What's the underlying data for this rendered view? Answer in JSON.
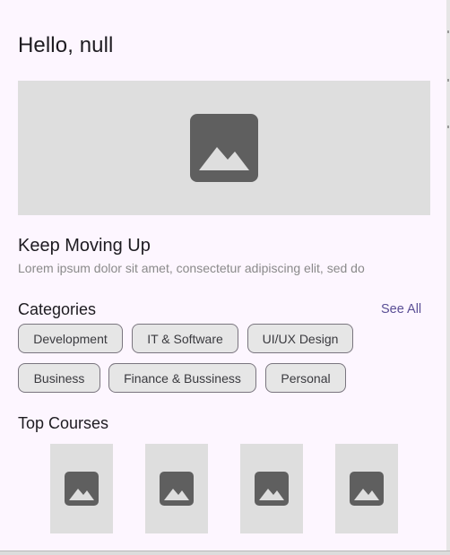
{
  "header": {
    "greeting": "Hello, null"
  },
  "banner": {
    "image_icon": "image-placeholder-icon"
  },
  "intro": {
    "title": "Keep Moving Up",
    "subtitle": "Lorem ipsum dolor sit amet, consectetur adipiscing elit, sed do"
  },
  "categories": {
    "title": "Categories",
    "see_all": "See All",
    "chips": [
      "Development",
      "IT & Software",
      "UI/UX Design",
      "Business",
      "Finance & Bussiness",
      "Personal"
    ]
  },
  "top_courses": {
    "title": "Top Courses",
    "items": [
      {
        "icon": "image-placeholder-icon"
      },
      {
        "icon": "image-placeholder-icon"
      },
      {
        "icon": "image-placeholder-icon"
      },
      {
        "icon": "image-placeholder-icon"
      }
    ]
  },
  "colors": {
    "background": "#fdf6ff",
    "placeholder": "#dedede",
    "icon": "#5f5f5f",
    "accent": "#5b4f96",
    "chip_bg": "#e6e6e6",
    "chip_border": "#7a757f"
  }
}
